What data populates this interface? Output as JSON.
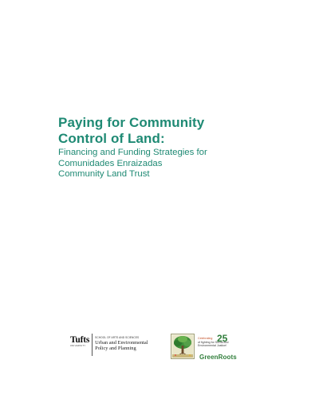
{
  "cover": {
    "title_lines": [
      "Paying for Community",
      "Control of Land:"
    ],
    "subtitle_lines": [
      "Financing and Funding Strategies for",
      "Comunidades Enraizadas",
      "Community Land Trust"
    ],
    "title_color": "#1f8a74"
  },
  "logos": {
    "tufts": {
      "name": "Tufts",
      "university": "UNIVERSITY",
      "school": "SCHOOL OF ARTS AND SCIENCES",
      "program_lines": [
        "Urban and Environmental",
        "Policy and Planning"
      ]
    },
    "greenroots": {
      "number": "25",
      "tagline_lines": [
        "Celebrating",
        "of fighting for Social and",
        "Environmental Justice!"
      ],
      "years_label": "Years",
      "name": "GreenRoots",
      "brand_color": "#2f7d3a"
    }
  }
}
